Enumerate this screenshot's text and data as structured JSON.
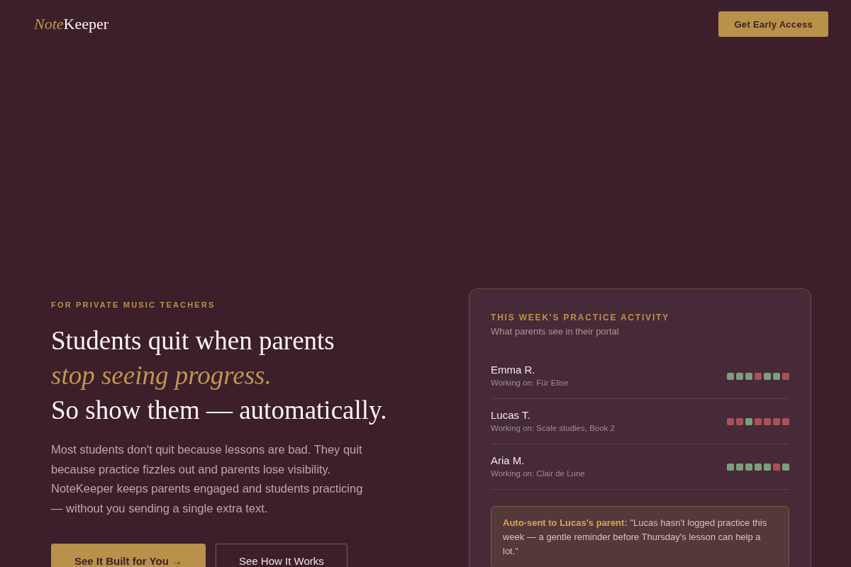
{
  "header": {
    "logo": {
      "accent": "Note",
      "rest": "Keeper"
    },
    "cta_button": "Get Early Access"
  },
  "hero": {
    "eyebrow": "FOR PRIVATE MUSIC TEACHERS",
    "headline": "Students quit when parents *stop seeing progress.* So show them — automatically.",
    "description": "Most students don't quit because lessons are bad. They quit because practice fizzles out and parents lose visibility. NoteKeeper keeps parents engaged and students practicing — without you sending a single extra text.",
    "buttons": [
      {
        "label": "See It Built for You →",
        "kind": "primary"
      },
      {
        "label": "See How It Works",
        "kind": "secondary"
      }
    ]
  },
  "activity_card": {
    "title": "THIS WEEK'S PRACTICE ACTIVITY",
    "subtitle": "What parents see in their portal",
    "students": [
      {
        "name": "Emma R.",
        "piece": "Working on: Für Elise",
        "days": [
          {
            "practiced": true
          },
          {
            "practiced": true
          },
          {
            "practiced": true
          },
          {
            "practiced": false
          },
          {
            "practiced": true
          },
          {
            "practiced": true
          },
          {
            "practiced": false
          }
        ]
      },
      {
        "name": "Lucas T.",
        "piece": "Working on: Scale studies, Book 2",
        "days": [
          {
            "practiced": false
          },
          {
            "practiced": false
          },
          {
            "practiced": true
          },
          {
            "practiced": false
          },
          {
            "practiced": false
          },
          {
            "practiced": false
          },
          {
            "practiced": false
          }
        ]
      },
      {
        "name": "Aria M.",
        "piece": "Working on: Clair de Lune",
        "days": [
          {
            "practiced": true
          },
          {
            "practiced": true
          },
          {
            "practiced": true
          },
          {
            "practiced": true
          },
          {
            "practiced": true
          },
          {
            "practiced": false
          },
          {
            "practiced": true
          }
        ]
      }
    ],
    "message": "**Auto-sent to Lucas's parent:** \"Lucas hasn't logged practice this week — a gentle reminder before Thursday's lesson can help a lot.\""
  }
}
